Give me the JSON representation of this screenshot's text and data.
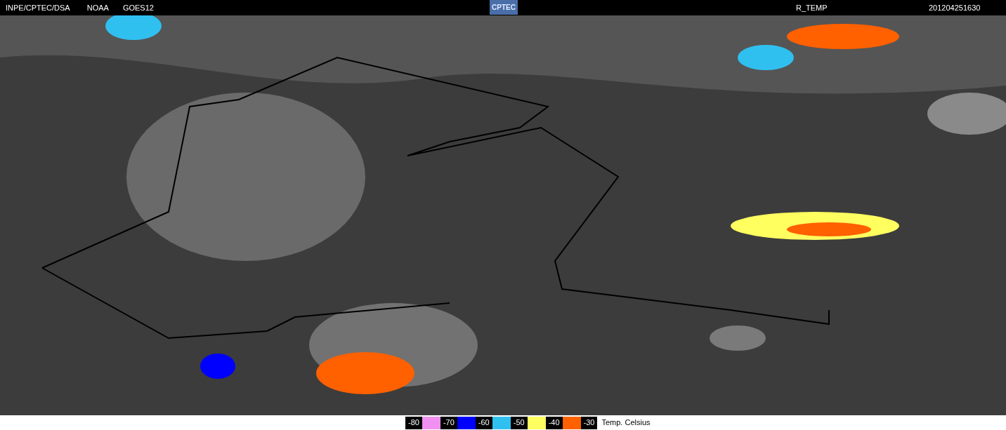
{
  "header": {
    "source": "INPE/CPTEC/DSA",
    "agency": "NOAA",
    "satellite": "GOES12",
    "logo": "CPTEC",
    "product": "R_TEMP",
    "timestamp": "201204251630"
  },
  "legend": {
    "items": [
      {
        "label": "-80",
        "color": "#f090f0"
      },
      {
        "label": "-70",
        "color": "#0000ff"
      },
      {
        "label": "-60",
        "color": "#30c0f0"
      },
      {
        "label": "-50",
        "color": "#ffff60"
      },
      {
        "label": "-40",
        "color": "#ff6000"
      },
      {
        "label": "-30"
      }
    ],
    "title": "Temp. Celsius"
  }
}
